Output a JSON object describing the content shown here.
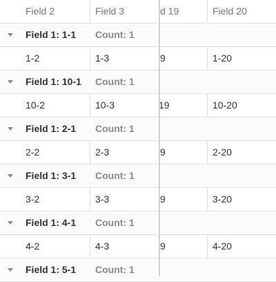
{
  "columns": {
    "field2": "Field 2",
    "field3": "Field 3",
    "field19": "d 19",
    "field20": "Field 20"
  },
  "groups": [
    {
      "title": "Field 1: 1-1",
      "count": "Count: 1",
      "row": {
        "f2": "1-2",
        "f3": "1-3",
        "f19": "9",
        "f20": "1-20"
      }
    },
    {
      "title": "Field 1: 10-1",
      "count": "Count: 1",
      "row": {
        "f2": "10-2",
        "f3": "10-3",
        "f19": "19",
        "f20": "10-20"
      }
    },
    {
      "title": "Field 1: 2-1",
      "count": "Count: 1",
      "row": {
        "f2": "2-2",
        "f3": "2-3",
        "f19": "9",
        "f20": "2-20"
      }
    },
    {
      "title": "Field 1: 3-1",
      "count": "Count: 1",
      "row": {
        "f2": "3-2",
        "f3": "3-3",
        "f19": "9",
        "f20": "3-20"
      }
    },
    {
      "title": "Field 1: 4-1",
      "count": "Count: 1",
      "row": {
        "f2": "4-2",
        "f3": "4-3",
        "f19": "9",
        "f20": "4-20"
      }
    },
    {
      "title": "Field 1: 5-1",
      "count": "Count: 1"
    }
  ]
}
